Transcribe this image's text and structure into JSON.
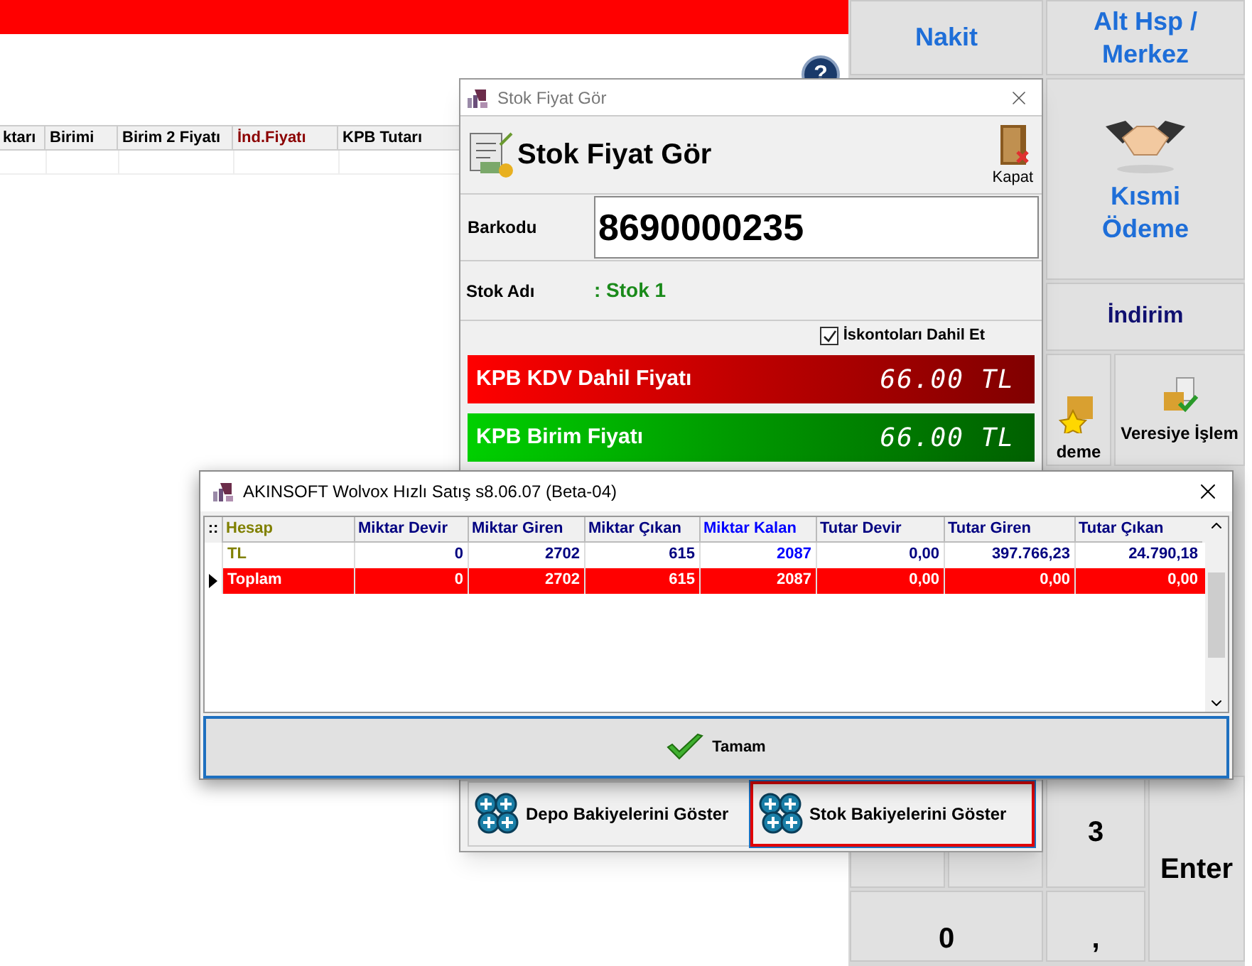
{
  "background": {
    "help_label": "?",
    "table": {
      "columns": [
        {
          "label": "ktarı",
          "color": "#000000"
        },
        {
          "label": "Birimi",
          "color": "#000000"
        },
        {
          "label": "Birim 2 Fiyatı",
          "color": "#000000"
        },
        {
          "label": "İnd.Fiyatı",
          "color": "#8b0000"
        },
        {
          "label": "KPB Tutarı",
          "color": "#000000"
        }
      ]
    }
  },
  "keypad": [
    {
      "label": "Nakit",
      "kind": "text"
    },
    {
      "label": "Alt Hsp / Merkez",
      "kind": "text"
    },
    {
      "label": "Kısmi Ödeme",
      "kind": "handshake"
    },
    {
      "label": "İndirim",
      "kind": "dark"
    },
    {
      "label": "deme",
      "kind": "star"
    },
    {
      "label": "Veresiye İşlem",
      "kind": "box"
    },
    {
      "kind": "blank"
    },
    {
      "kind": "blank"
    },
    {
      "label": "3",
      "kind": "key"
    },
    {
      "label": "Enter",
      "kind": "key"
    },
    {
      "label": "0",
      "kind": "key"
    },
    {
      "label": ",",
      "kind": "key"
    }
  ],
  "price_window": {
    "title": "Stok Fiyat Gör",
    "heading": "Stok Fiyat Gör",
    "close_label": "Kapat",
    "barcode_label": "Barkodu",
    "barcode_value": "8690000235",
    "stock_name_label": "Stok Adı",
    "stock_name_value": ": Stok 1",
    "discount_checkbox": {
      "label": "İskontoları Dahil Et",
      "checked": true
    },
    "prices": [
      {
        "label": "KPB KDV Dahil Fiyatı",
        "value": "66.00 TL",
        "kind": "red"
      },
      {
        "label": "KPB Birim Fiyatı",
        "value": "66.00 TL",
        "kind": "green"
      }
    ],
    "buttons": [
      {
        "label": "Depo Bakiyelerini Göster",
        "selected": false
      },
      {
        "label": "Stok Bakiyelerini Göster",
        "selected": true
      }
    ]
  },
  "balance_window": {
    "title": "AKINSOFT Wolvox Hızlı Satış s8.06.07 (Beta-04)",
    "corner_label": "::",
    "columns": [
      {
        "label": "Hesap",
        "color": "#808000"
      },
      {
        "label": "Miktar Devir",
        "color": "#000080"
      },
      {
        "label": "Miktar Giren",
        "color": "#000080"
      },
      {
        "label": "Miktar Çıkan",
        "color": "#000080"
      },
      {
        "label": "Miktar Kalan",
        "color": "#0000ff"
      },
      {
        "label": "Tutar Devir",
        "color": "#000080"
      },
      {
        "label": "Tutar Giren",
        "color": "#000080"
      },
      {
        "label": "Tutar Çıkan",
        "color": "#000080"
      }
    ],
    "rows": [
      {
        "selected": false,
        "cells": [
          "TL",
          "0",
          "2702",
          "615",
          "2087",
          "0,00",
          "397.766,23",
          "24.790,18"
        ]
      },
      {
        "selected": true,
        "cells": [
          "Toplam",
          "0",
          "2702",
          "615",
          "2087",
          "0,00",
          "0,00",
          "0,00"
        ]
      }
    ],
    "button": "Tamam"
  }
}
